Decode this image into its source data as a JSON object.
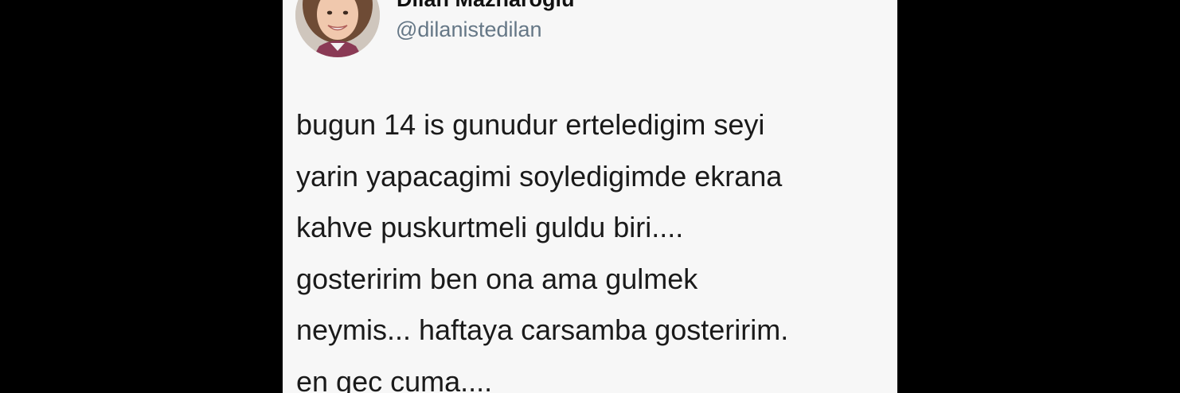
{
  "tweet": {
    "display_name": "Dilan Mazharoglu",
    "handle": "@dilanistedilan",
    "lines": [
      "bugun 14 is gunudur erteledigim seyi",
      "yarin yapacagimi soyledigimde ekrana",
      "kahve puskurtmeli guldu biri....",
      "gosteririm ben ona ama gulmek",
      "neymis... haftaya carsamba gosteririm.",
      "en gec cuma...."
    ]
  },
  "colors": {
    "background": "#000000",
    "card": "#f7f7f7",
    "text": "#1a1a1a",
    "handle": "#657786"
  }
}
